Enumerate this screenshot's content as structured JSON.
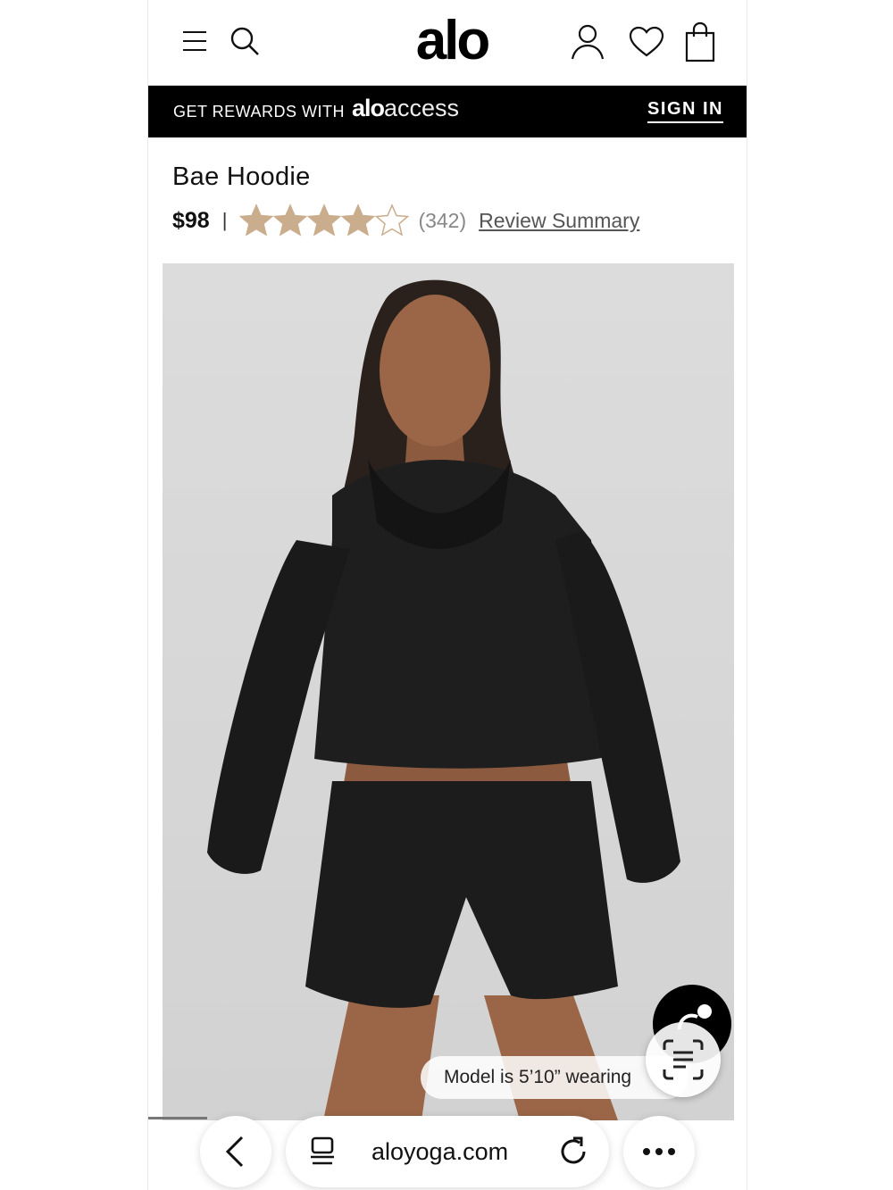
{
  "header": {
    "logo": "alo",
    "icons": [
      "menu-icon",
      "search-icon",
      "account-icon",
      "heart-icon",
      "bag-icon"
    ]
  },
  "rewards_bar": {
    "text": "GET REWARDS WITH",
    "brand_bold": "alo",
    "brand_light": "access",
    "sign_in": "SIGN IN"
  },
  "product": {
    "title": "Bae Hoodie",
    "price": "$98",
    "separator": "|",
    "rating": 4,
    "rating_max": 5,
    "review_count": "(342)",
    "review_link": "Review Summary",
    "model_note": "Model is 5’10” wearing",
    "colors": {
      "star": "#c9ad8c",
      "background": "#dadada"
    }
  },
  "browser": {
    "url": "aloyoga.com",
    "icons": [
      "back-icon",
      "tabs-icon",
      "reload-icon",
      "more-icon"
    ]
  }
}
